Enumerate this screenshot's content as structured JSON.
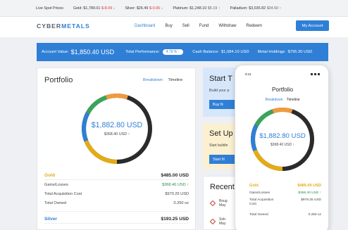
{
  "ticker": {
    "label": "Live Spot Prices",
    "gold": {
      "label": "Gold:",
      "price": "$1,789.01",
      "change": "$-8.09",
      "arrow": "↓"
    },
    "silver": {
      "label": "Silver:",
      "price": "$26.49",
      "change": "$-0.06",
      "arrow": "↓"
    },
    "platinum": {
      "label": "Platinum:",
      "price": "$1,248.10",
      "change": "$5.19",
      "arrow": "↑"
    },
    "palladium": {
      "label": "Palladium:",
      "price": "$3,035.82",
      "change": "$34.50",
      "arrow": "↑"
    }
  },
  "nav": {
    "logo_a": "CYBER",
    "logo_b": "METALS",
    "links": [
      "Dashboard",
      "Buy",
      "Sell",
      "Fund",
      "Withdraw",
      "Redeem"
    ],
    "account_button": "My Account"
  },
  "summary": {
    "account_value_label": "Account Value:",
    "account_value": "$1,850.40 USD",
    "performance_label": "Total Performance:",
    "performance_value": "4.79 % ↑",
    "cash_label": "Cash Balance:",
    "cash_value": "$1,084.10 USD",
    "holdings_label": "Metal Holdings:",
    "holdings_value": "$795.30 USD"
  },
  "portfolio": {
    "title": "Portfolio",
    "tabs": [
      "Breakdown",
      "Timeline"
    ],
    "total": "$1,882.80 USD",
    "gain": "$368.40 USD ↑",
    "ring_colors": {
      "gold": "#e3ac14",
      "silver": "#2f7fd6",
      "green": "#3aa55a",
      "orange": "#f09a3e",
      "dark": "#2b2b2b"
    },
    "gold": {
      "name": "Gold",
      "value": "$485.00 USD",
      "gains_label": "Gains/Losses",
      "gains_value": "$368.40 USD ↑",
      "cost_label": "Total Acquisition Cost",
      "cost_value": "$970.25 USD",
      "owned_label": "Total Owned",
      "owned_value": "0.250 oz"
    },
    "silver": {
      "name": "Silver",
      "value": "$193.25 USD"
    }
  },
  "start_card": {
    "title": "Start T",
    "text": "Build your p",
    "button": "Buy N"
  },
  "setup_card": {
    "title": "Set Up",
    "text": "Start buildin",
    "button": "Start N"
  },
  "recent_card": {
    "title": "Recent",
    "items": [
      "Boug",
      "Solc"
    ],
    "subs": [
      "May",
      "May"
    ]
  },
  "phone": {
    "time": "9:41",
    "title": "Portfolio",
    "tabs": [
      "Breakdown",
      "Timeline"
    ],
    "total": "$1,882.80 USD",
    "gain": "$368.40 USD ↑",
    "gold": {
      "name": "Gold",
      "value": "$485.00 USD",
      "gains_label": "Gains/Losses",
      "gains_value": "$368.40 USD ↑",
      "cost_label": "Total Acquisition Cost",
      "cost_value": "$979.25 USD",
      "owned_label": "Total Owned",
      "owned_value": "0.250 oz"
    }
  }
}
